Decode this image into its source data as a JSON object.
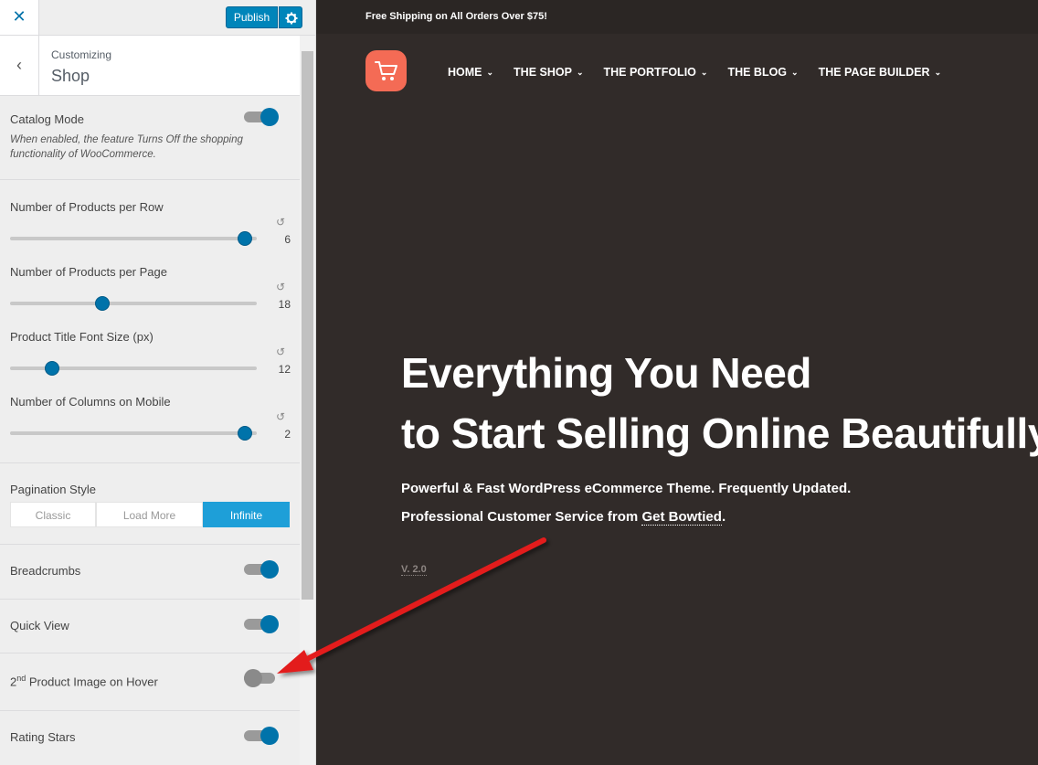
{
  "topbar": {
    "close_symbol": "✕",
    "publish_label": "Publish",
    "settings_icon": "gear-icon"
  },
  "panel": {
    "back_symbol": "‹",
    "breadcrumb": "Customizing",
    "title": "Shop"
  },
  "controls": {
    "catalog_mode": {
      "label": "Catalog Mode",
      "description": "When enabled, the feature Turns Off the shopping functionality of WooCommerce.",
      "enabled": true
    },
    "sliders": [
      {
        "label": "Number of Products per Row",
        "value": "6",
        "fraction": 0.95
      },
      {
        "label": "Number of Products per Page",
        "value": "18",
        "fraction": 0.375
      },
      {
        "label": "Product Title Font Size (px)",
        "value": "12",
        "fraction": 0.17
      },
      {
        "label": "Number of Columns on Mobile",
        "value": "2",
        "fraction": 0.95
      }
    ],
    "reset_symbol": "↺",
    "pagination": {
      "label": "Pagination Style",
      "options": [
        "Classic",
        "Load More",
        "Infinite"
      ],
      "selected": "Infinite"
    },
    "breadcrumbs": {
      "label": "Breadcrumbs",
      "enabled": true
    },
    "quick_view": {
      "label": "Quick View",
      "enabled": true
    },
    "second_image": {
      "label_sup": "2nd",
      "label_prefix": "2",
      "label_ordinal": "nd",
      "label_rest": " Product Image on Hover",
      "enabled": false
    },
    "rating_stars": {
      "label": "Rating Stars",
      "enabled": true
    }
  },
  "preview": {
    "promo": "Free Shipping on All Orders Over $75!",
    "nav": [
      "HOME",
      "THE SHOP",
      "THE PORTFOLIO",
      "THE BLOG",
      "THE PAGE BUILDER"
    ],
    "chevron_symbol": "⌄",
    "hero_line1": "Everything You Need",
    "hero_line2": "to Start Selling Online Beautifully",
    "sub_line1": "Powerful & Fast WordPress eCommerce Theme. Frequently Updated.",
    "sub_line2_prefix": "Professional Customer Service from ",
    "sub_line2_link": "Get Bowtied",
    "sub_line2_suffix": ".",
    "version": "V. 2.0"
  },
  "colors": {
    "accent": "#0073aa",
    "publish": "#0085ba",
    "logo": "#f46b55",
    "arrow": "#e31b1b",
    "preview_bg": "#312b29"
  }
}
